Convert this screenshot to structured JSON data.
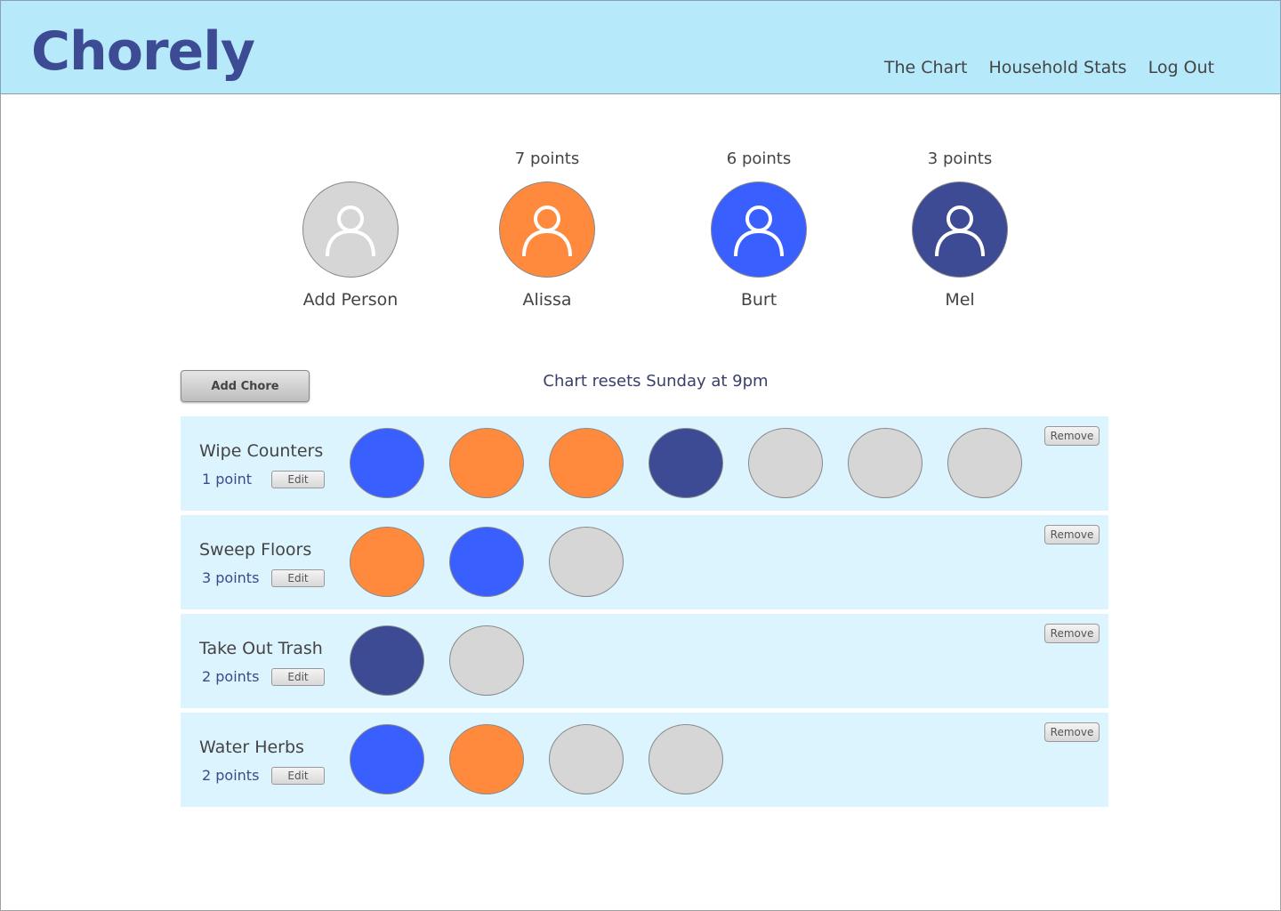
{
  "app": {
    "title": "Chorely"
  },
  "nav": [
    {
      "label": "The Chart"
    },
    {
      "label": "Household Stats"
    },
    {
      "label": "Log Out"
    }
  ],
  "colors": {
    "header_bg": "#b6eafb",
    "brand": "#3d4a94",
    "row_bg": "#dcf4fe",
    "alissa": "#ff8a3d",
    "burt": "#3a5fff",
    "mel": "#3d4a94",
    "empty": "#d6d6d6"
  },
  "people": [
    {
      "name": "Add Person",
      "points": "",
      "color_key": "empty",
      "icon": "person-icon"
    },
    {
      "name": "Alissa",
      "points": "7 points",
      "color_key": "alissa",
      "icon": "person-icon"
    },
    {
      "name": "Burt",
      "points": "6 points",
      "color_key": "burt",
      "icon": "person-icon"
    },
    {
      "name": "Mel",
      "points": "3 points",
      "color_key": "mel",
      "icon": "person-icon"
    }
  ],
  "toolbar": {
    "add_chore_label": "Add Chore",
    "reset_note": "Chart resets Sunday at 9pm"
  },
  "chores": [
    {
      "name": "Wipe Counters",
      "points": "1 point",
      "edit_label": "Edit",
      "remove_label": "Remove",
      "slots": [
        "burt",
        "alissa",
        "alissa",
        "mel",
        "empty",
        "empty",
        "empty"
      ]
    },
    {
      "name": "Sweep Floors",
      "points": "3 points",
      "edit_label": "Edit",
      "remove_label": "Remove",
      "slots": [
        "alissa",
        "burt",
        "empty"
      ]
    },
    {
      "name": "Take Out Trash",
      "points": "2 points",
      "edit_label": "Edit",
      "remove_label": "Remove",
      "slots": [
        "mel",
        "empty"
      ]
    },
    {
      "name": "Water Herbs",
      "points": "2 points",
      "edit_label": "Edit",
      "remove_label": "Remove",
      "slots": [
        "burt",
        "alissa",
        "empty",
        "empty"
      ]
    }
  ]
}
